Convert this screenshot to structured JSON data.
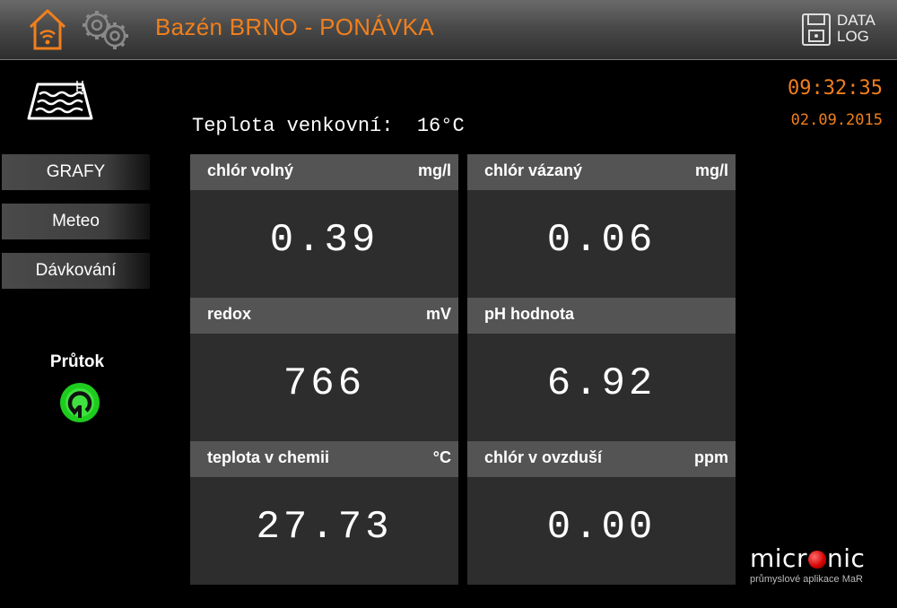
{
  "header": {
    "title": "Bazén BRNO - PONÁVKA",
    "home_icon": "home-wifi-icon",
    "settings_icon": "gears-icon",
    "datalog": {
      "line1": "DATA",
      "line2": "LOG",
      "icon": "floppy-disk-icon"
    }
  },
  "clock": {
    "time": "09:32:35",
    "date": "02.09.2015"
  },
  "outdoor": {
    "label": "Teplota venkovní:",
    "value": "16°C"
  },
  "nav": {
    "grafy": "GRAFY",
    "meteo": "Meteo",
    "davkovani": "Dávkování"
  },
  "flow": {
    "label": "Průtok",
    "status_color": "#1ecc1e"
  },
  "tiles": [
    {
      "label": "chlór volný",
      "unit": "mg/l",
      "value": "0.39"
    },
    {
      "label": "chlór vázaný",
      "unit": "mg/l",
      "value": "0.06"
    },
    {
      "label": "redox",
      "unit": "mV",
      "value": "766"
    },
    {
      "label": "pH hodnota",
      "unit": "",
      "value": "6.92"
    },
    {
      "label": "teplota v chemii",
      "unit": "°C",
      "value": "27.73"
    },
    {
      "label": "chlór v ovzduší",
      "unit": "ppm",
      "value": "0.00"
    }
  ],
  "logo": {
    "pre": "micr",
    "post": "nic",
    "subtitle": "průmyslové aplikace MaR"
  },
  "colors": {
    "accent": "#f07f1c",
    "header_bg": "#4a4a4a",
    "tile_header": "#545454",
    "tile_body": "#2d2d2d"
  }
}
